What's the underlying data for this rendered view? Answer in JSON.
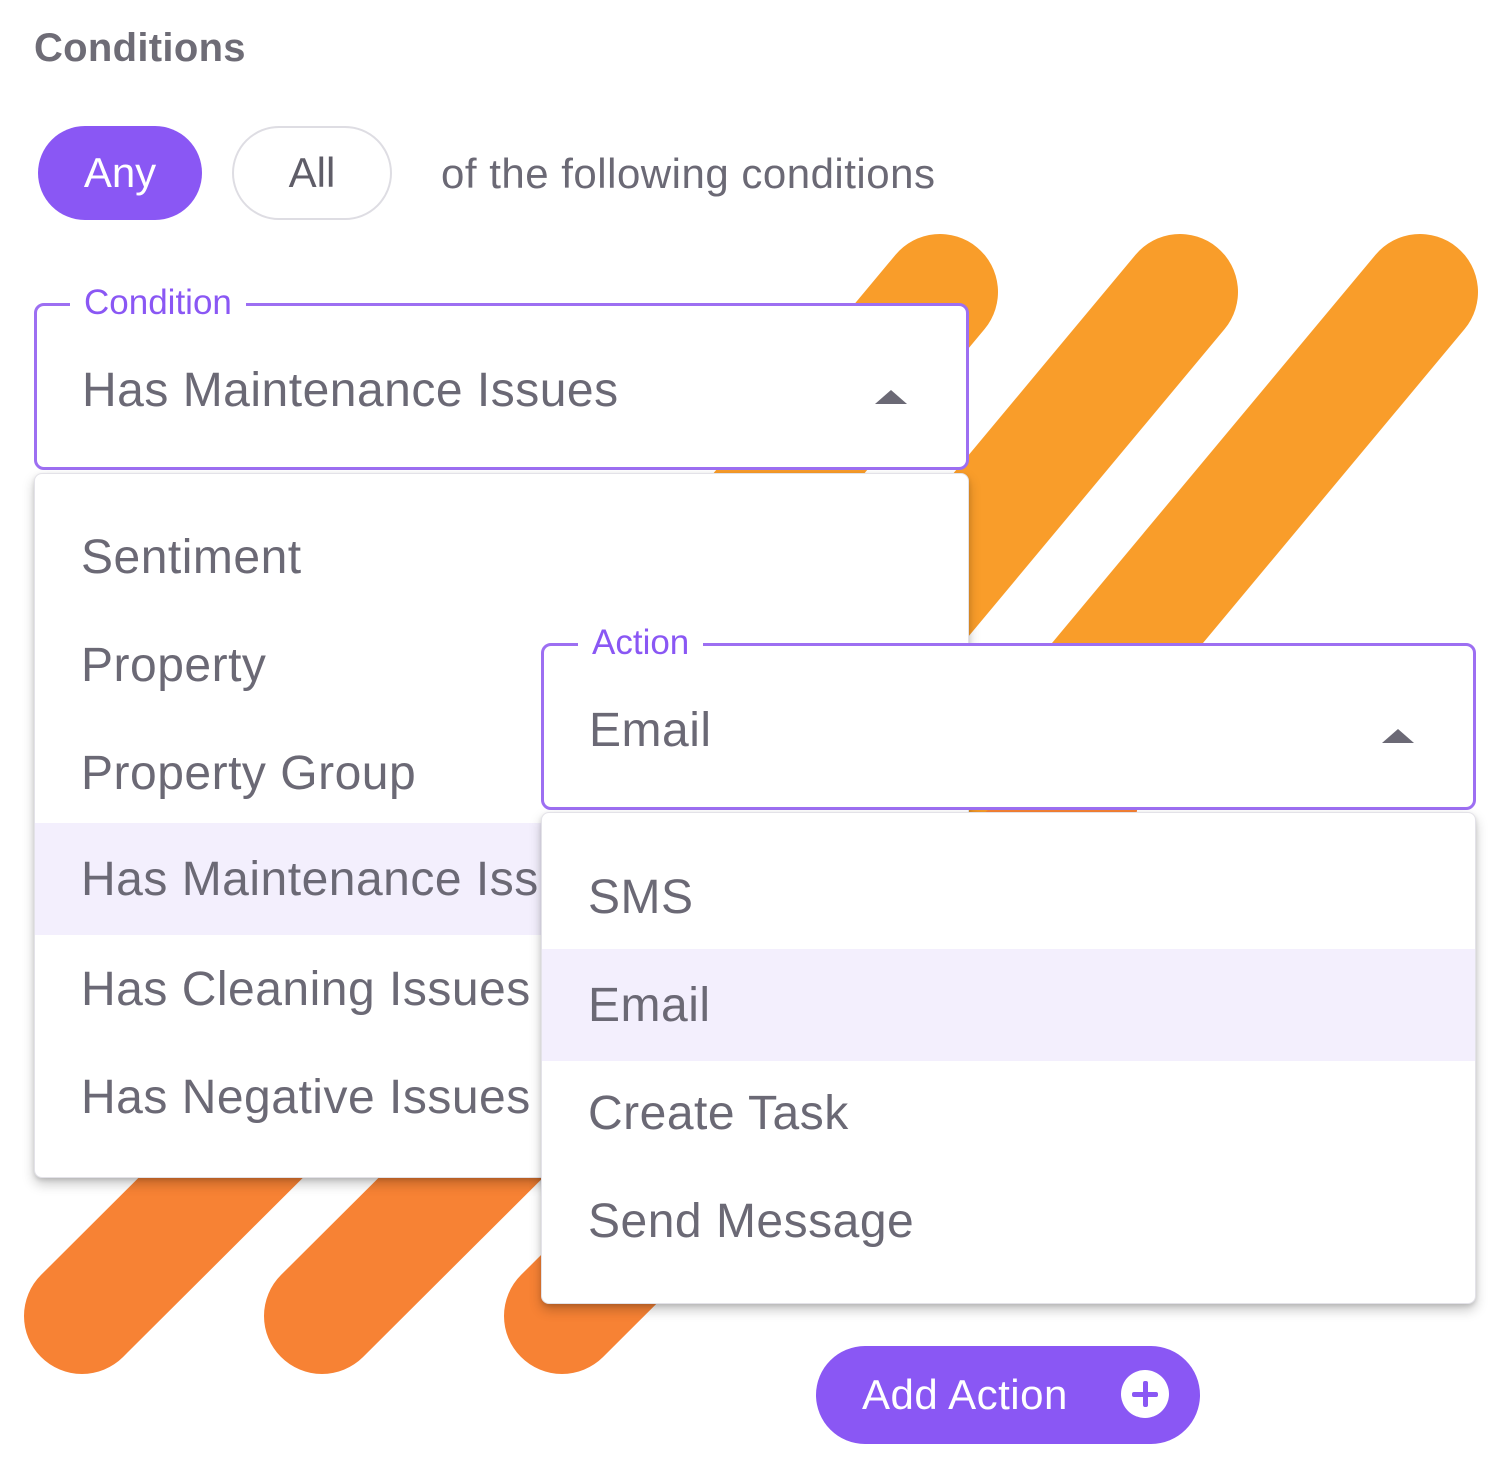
{
  "header": {
    "title": "Conditions"
  },
  "match": {
    "any_label": "Any",
    "all_label": "All",
    "selected": "Any",
    "suffix_text": "of the following conditions"
  },
  "condition_field": {
    "label": "Condition",
    "value": "Has Maintenance Issues",
    "options": [
      "Sentiment",
      "Property",
      "Property Group",
      "Has Maintenance Issues",
      "Has Cleaning Issues",
      "Has Negative Issues"
    ],
    "selected_index": 3
  },
  "action_field": {
    "label": "Action",
    "value": "Email",
    "options": [
      "SMS",
      "Email",
      "Create Task",
      "Send Message"
    ],
    "selected_index": 1
  },
  "add_action": {
    "label": "Add Action",
    "icon": "plus-circle-icon"
  },
  "colors": {
    "accent": "#8a57f4",
    "stripe_top": "#f99d2a",
    "stripe_bottom": "#f78234",
    "selected_bg": "#f3effd"
  }
}
